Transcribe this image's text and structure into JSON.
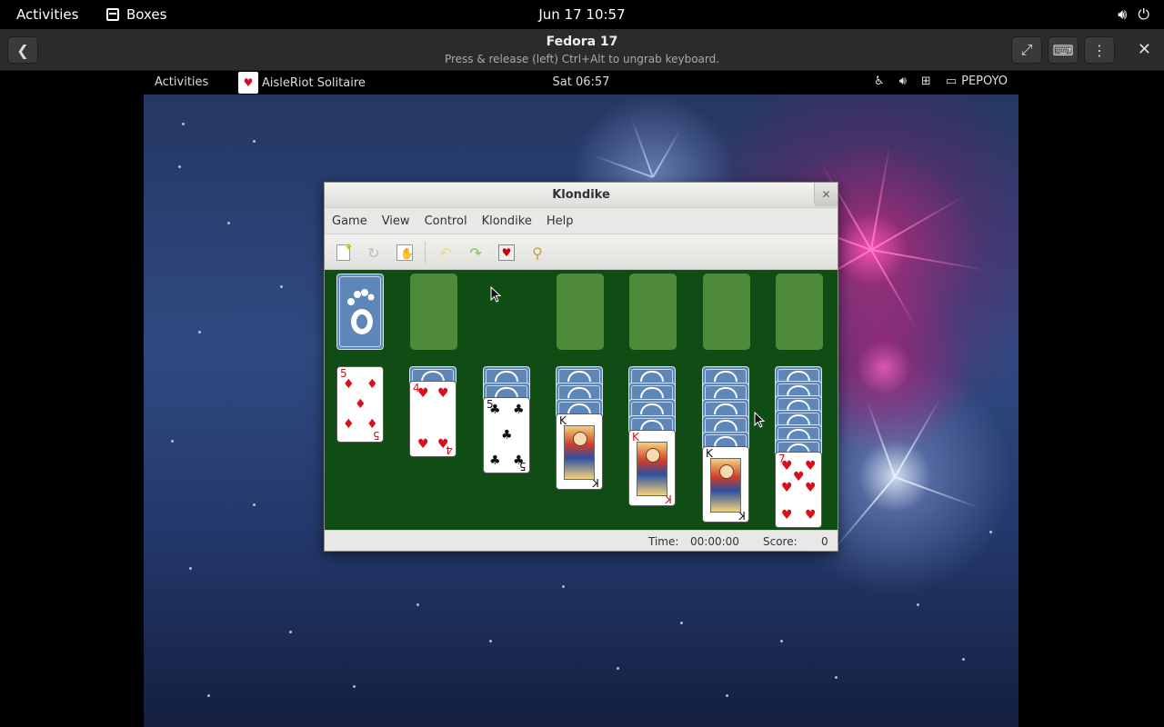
{
  "host": {
    "activities": "Activities",
    "app_name": "Boxes",
    "clock": "Jun 17  10:57"
  },
  "boxes": {
    "title": "Fedora 17",
    "subtitle": "Press & release (left) Ctrl+Alt to ungrab keyboard."
  },
  "guest": {
    "activities": "Activities",
    "app_name": "AisleRiot Solitaire",
    "clock": "Sat 06:57",
    "user": "PEPOYO"
  },
  "window": {
    "title": "Klondike",
    "menu": [
      "Game",
      "View",
      "Control",
      "Klondike",
      "Help"
    ],
    "toolbar_icons": [
      "new-game-icon",
      "restart-icon",
      "select-game-icon",
      "undo-icon",
      "redo-icon",
      "deal-icon",
      "hint-icon"
    ]
  },
  "game": {
    "foundations": 4,
    "waste_empty": true,
    "tableau": [
      {
        "face_down": 0,
        "top": {
          "rank": "5",
          "suit": "♦",
          "color": "red"
        }
      },
      {
        "face_down": 1,
        "top": {
          "rank": "4",
          "suit": "♥",
          "color": "red"
        }
      },
      {
        "face_down": 2,
        "top": {
          "rank": "5",
          "suit": "♣",
          "color": "black"
        }
      },
      {
        "face_down": 3,
        "top": {
          "rank": "K",
          "suit": "♣",
          "color": "black"
        }
      },
      {
        "face_down": 4,
        "top": {
          "rank": "K",
          "suit": "♥",
          "color": "red"
        }
      },
      {
        "face_down": 5,
        "top": {
          "rank": "K",
          "suit": "♠",
          "color": "black"
        }
      },
      {
        "face_down": 6,
        "top": {
          "rank": "7",
          "suit": "♥",
          "color": "red"
        }
      }
    ]
  },
  "status": {
    "time_label": "Time:",
    "time_value": "00:00:00",
    "score_label": "Score:",
    "score_value": "0"
  }
}
